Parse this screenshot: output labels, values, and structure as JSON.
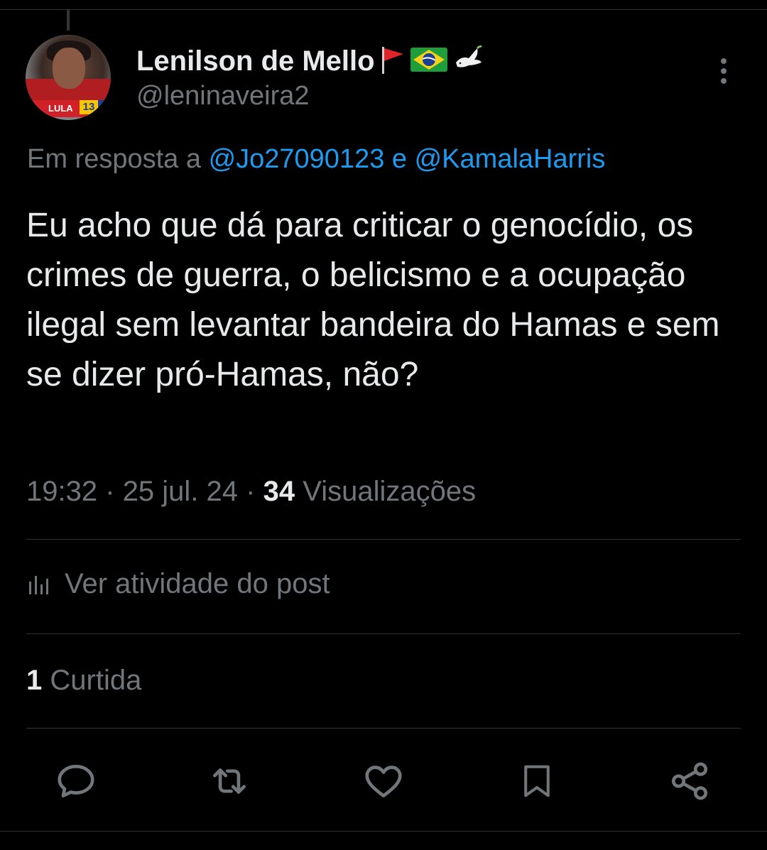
{
  "author": {
    "name": "Lenilson de Mello",
    "handle": "@leninaveira2",
    "avatar_badge_text": "LULA",
    "avatar_badge_number": "13"
  },
  "reply": {
    "prefix": "Em resposta a",
    "mention_1": "@Jo27090123",
    "connector": "e",
    "mention_2": "@KamalaHarris"
  },
  "tweet": {
    "text": "Eu acho que dá para criticar o genocídio, os crimes de guerra, o belicismo e a ocupação ilegal sem levantar bandeira do Hamas e sem se dizer pró-Hamas, não?"
  },
  "meta": {
    "time": "19:32",
    "date": "25 jul. 24",
    "separator": "·",
    "views_count": "34",
    "views_label": "Visualizações"
  },
  "activity": {
    "label": "Ver atividade do post"
  },
  "stats": {
    "likes_count": "1",
    "likes_label": "Curtida"
  },
  "colors": {
    "background": "#000000",
    "text": "#e7e9ea",
    "secondary": "#71767b",
    "accent": "#1d9bf0",
    "divider": "#2f3336"
  },
  "icons": {
    "more": "more-vertical-icon",
    "activity": "bar-chart-icon",
    "reply": "reply-icon",
    "retweet": "retweet-icon",
    "like": "heart-icon",
    "bookmark": "bookmark-icon",
    "share": "share-icon"
  }
}
